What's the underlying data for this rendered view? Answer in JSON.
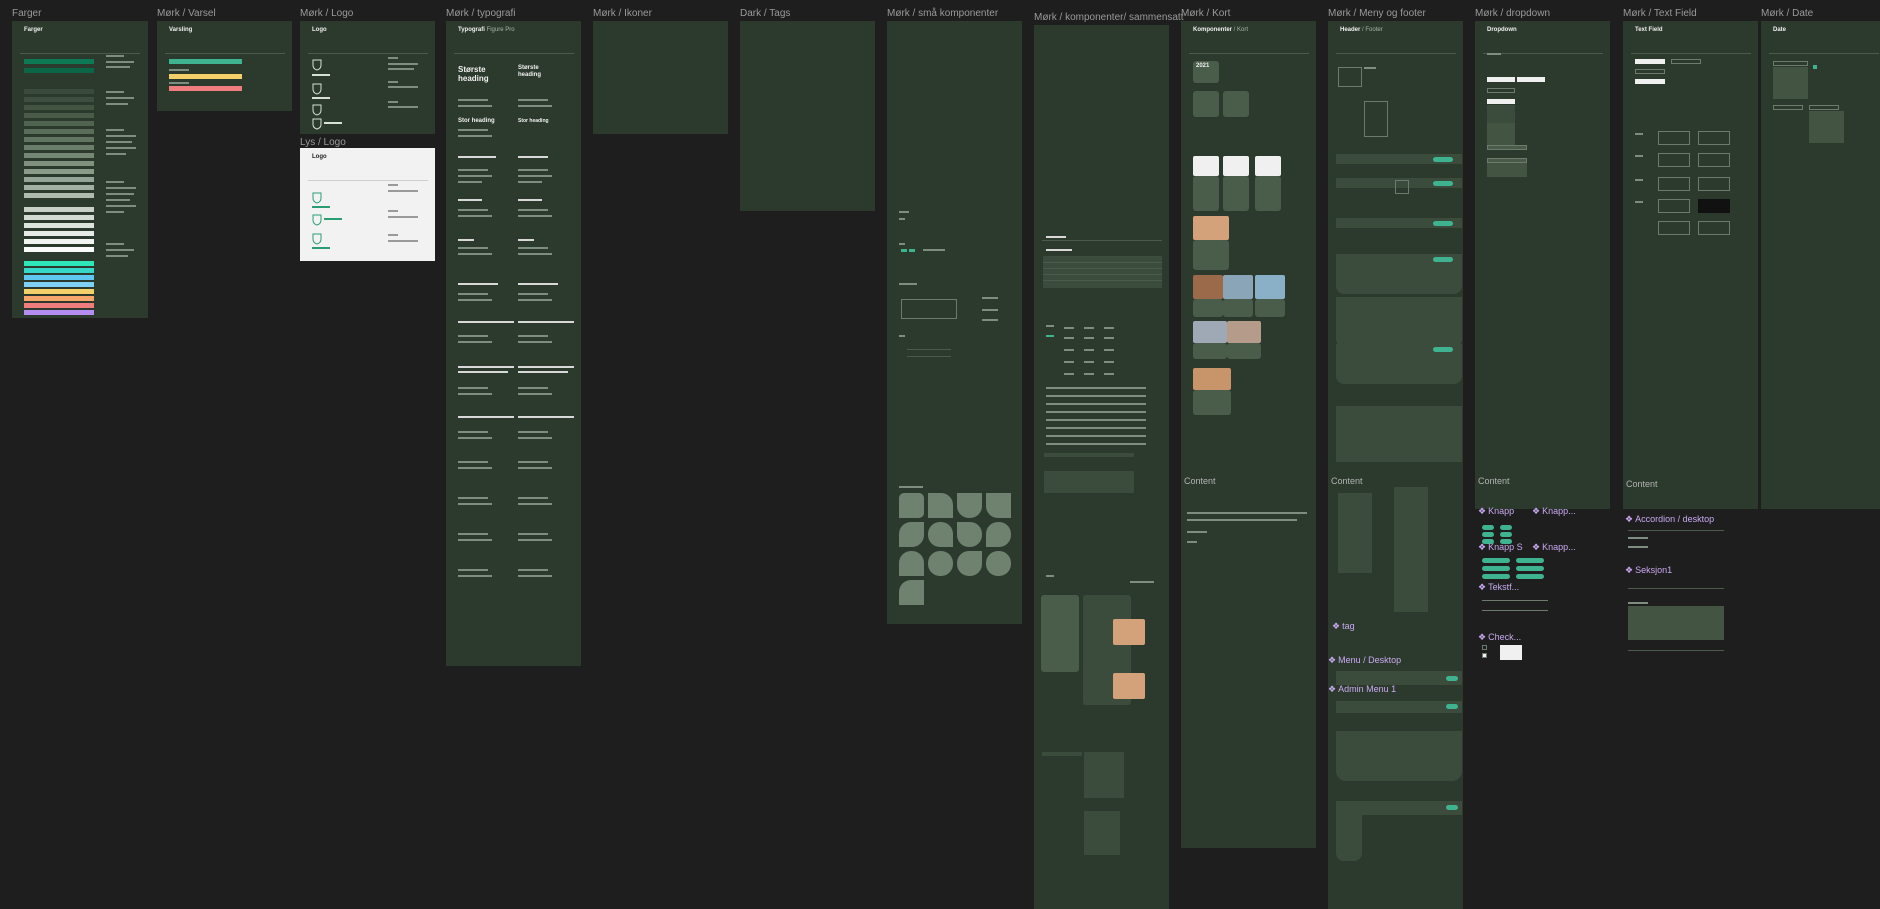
{
  "frames": {
    "farger": {
      "label": "Farger",
      "title": "Farger"
    },
    "varsel": {
      "label": "Mørk / Varsel",
      "title": "Varsling"
    },
    "logo": {
      "label": "Mørk / Logo",
      "title": "Logo"
    },
    "lys_logo": {
      "label": "Lys / Logo",
      "title": "Logo"
    },
    "typografi": {
      "label": "Mørk / typografi",
      "title": "Typografi",
      "subtitle": "Figure Pro",
      "heading_1": "Største heading",
      "heading_2": "Stor heading"
    },
    "ikoner": {
      "label": "Mørk / Ikoner"
    },
    "tags": {
      "label": "Dark / Tags"
    },
    "sma_komponenter": {
      "label": "Mørk /  små komponenter"
    },
    "sammensatt": {
      "label": "Mørk / komponenter/ sammensatt"
    },
    "kort": {
      "label": "Mørk / Kort",
      "title": "Komponenter",
      "subtitle": "/ Kort",
      "year": "2021",
      "content": "Content"
    },
    "meny_footer": {
      "label": "Mørk / Meny og footer",
      "title": "Header",
      "subtitle": "/ Footer",
      "content": "Content"
    },
    "dropdown": {
      "label": "Mørk / dropdown",
      "title": "Dropdown",
      "content": "Content"
    },
    "text_field": {
      "label": "Mørk / Text Field",
      "title": "Text Field",
      "content": "Content"
    },
    "date": {
      "label": "Mørk / Date",
      "title": "Date"
    }
  },
  "components": {
    "tag": "tag",
    "menu_desktop": "Menu / Desktop",
    "admin_menu": "Admin Menu 1",
    "knapp": "Knapp",
    "knapp_2": "Knapp...",
    "knapp_s": "Knapp S",
    "knapp_3": "Knapp...",
    "tekst": "Tekstf...",
    "check": "Check...",
    "accordion": "Accordion / desktop",
    "seksjon": "Seksjon1"
  },
  "colors": {
    "canvas": "#1e1e1e",
    "frame_dark": "#2c3a2d",
    "frame_light": "#f2f2f2",
    "accent": "#3fb28f",
    "component_label": "#c9a9f0"
  }
}
